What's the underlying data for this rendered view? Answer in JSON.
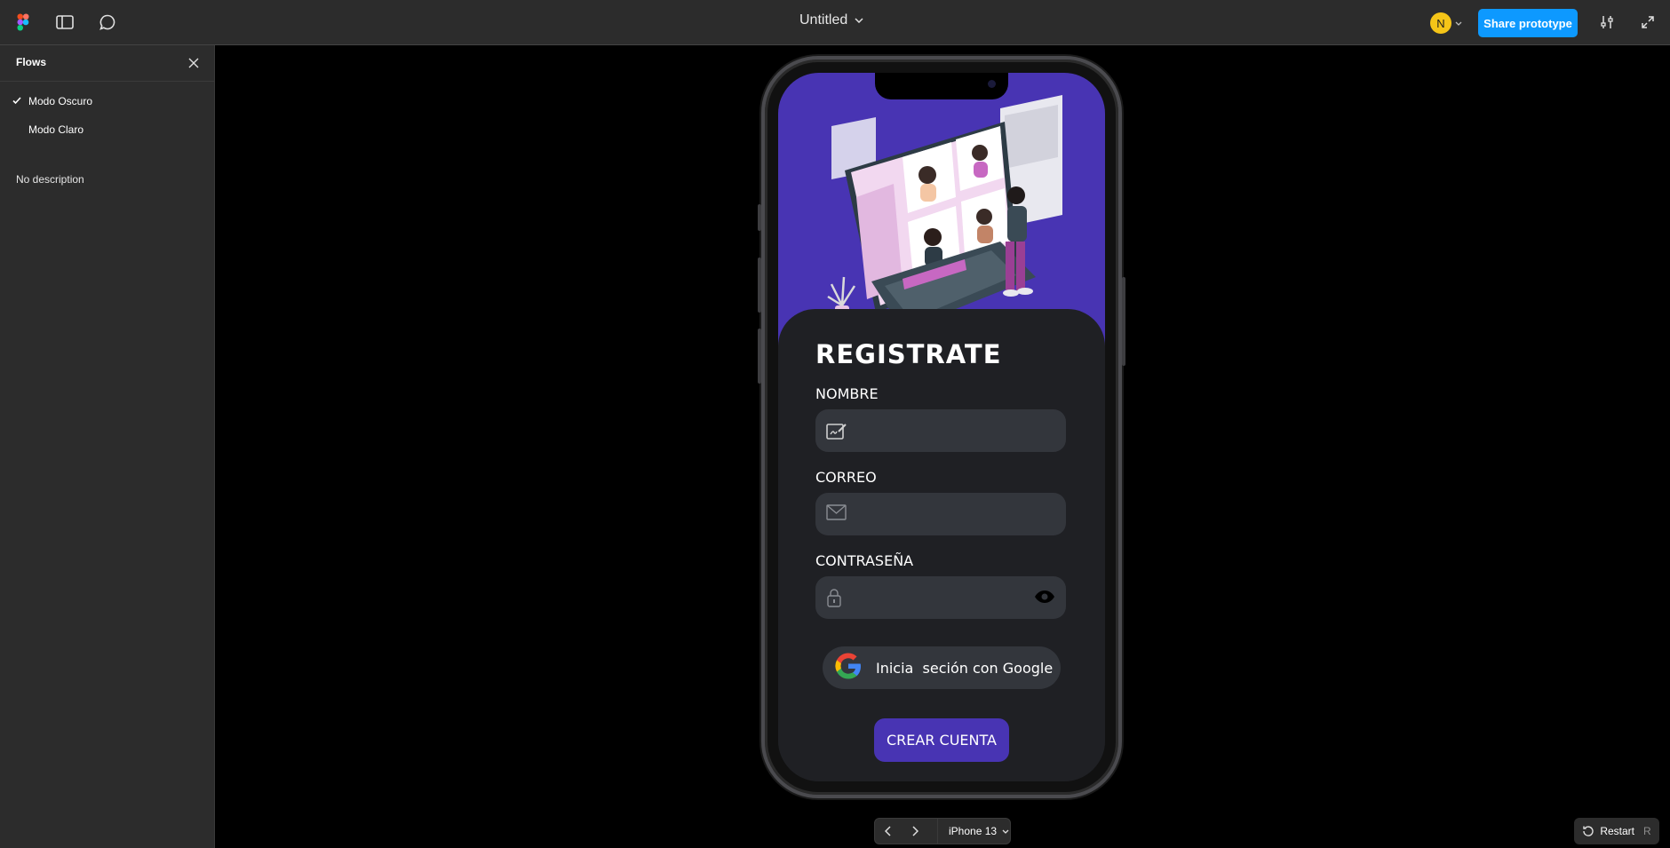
{
  "topbar": {
    "doc_title": "Untitled",
    "avatar_initial": "N",
    "share_label": "Share prototype"
  },
  "sidebar": {
    "title": "Flows",
    "flows": [
      {
        "label": "Modo Oscuro",
        "selected": true
      },
      {
        "label": "Modo Claro",
        "selected": false
      }
    ],
    "description": "No description"
  },
  "app": {
    "title": "REGISTRATE",
    "name_label": "NOMBRE",
    "email_label": "CORREO",
    "password_label": "CONTRASEÑA",
    "google_label": "Inicia  seción con Google",
    "create_label": "CREAR CUENTA",
    "colors": {
      "accent": "#4834b3",
      "panel": "#1f2024",
      "field": "#33363c"
    }
  },
  "bottom": {
    "device": "iPhone 13",
    "restart_label": "Restart",
    "restart_key": "R"
  },
  "icons": [
    "figma-logo-icon",
    "sidebar-toggle-icon",
    "comment-icon",
    "chevron-down-icon",
    "settings-sliders-icon",
    "fullscreen-icon",
    "close-icon",
    "check-icon",
    "signature-icon",
    "mail-icon",
    "lock-icon",
    "eye-icon",
    "google-icon",
    "chevron-left-icon",
    "chevron-right-icon",
    "restart-icon"
  ]
}
